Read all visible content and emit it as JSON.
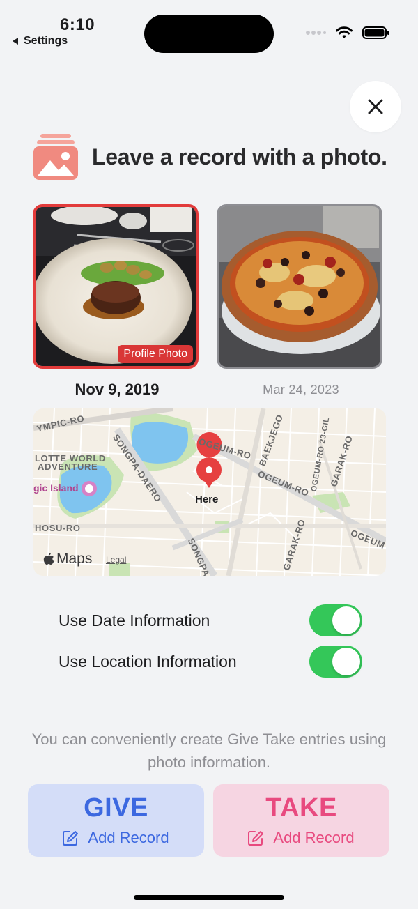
{
  "status_bar": {
    "time": "6:10",
    "back_label": "Settings"
  },
  "header": {
    "title": "Leave a record with a photo."
  },
  "photos": [
    {
      "date": "Nov 9, 2019",
      "badge": "Profile Photo",
      "selected": true
    },
    {
      "date": "Mar 24, 2023",
      "selected": false
    }
  ],
  "map": {
    "pin_label": "Here",
    "brand": "Maps",
    "legal": "Legal",
    "labels": {
      "olympic": "YMPIC-RO",
      "lotte_1": "LOTTE WORLD",
      "lotte_2": "ADVENTURE",
      "island": "gic Island",
      "songpa": "SONGPA-DAERO",
      "ogeum_1": "OGEUM-RO",
      "ogeum_2": "OGEUM-RO",
      "ogeum_3": "OGEUM",
      "baekjegobun": "BAEKJEGO",
      "ogeum23": "OGEUM-RO 23-GIL",
      "garak_1": "GARAK-RO",
      "garak_2": "GARAK-RO",
      "hosu": "HOSU-RO",
      "songpa_2": "SONGPA"
    }
  },
  "toggles": [
    {
      "label": "Use Date Information",
      "on": true
    },
    {
      "label": "Use Location Information",
      "on": true
    }
  ],
  "hint": "You can conveniently create Give Take entries using photo information.",
  "actions": {
    "give": {
      "title": "GIVE",
      "sub": "Add Record"
    },
    "take": {
      "title": "TAKE",
      "sub": "Add Record"
    }
  },
  "colors": {
    "give_accent": "#3c68e0",
    "take_accent": "#e84a7f",
    "switch_on": "#34c759",
    "selected_border": "#e23b3b"
  }
}
